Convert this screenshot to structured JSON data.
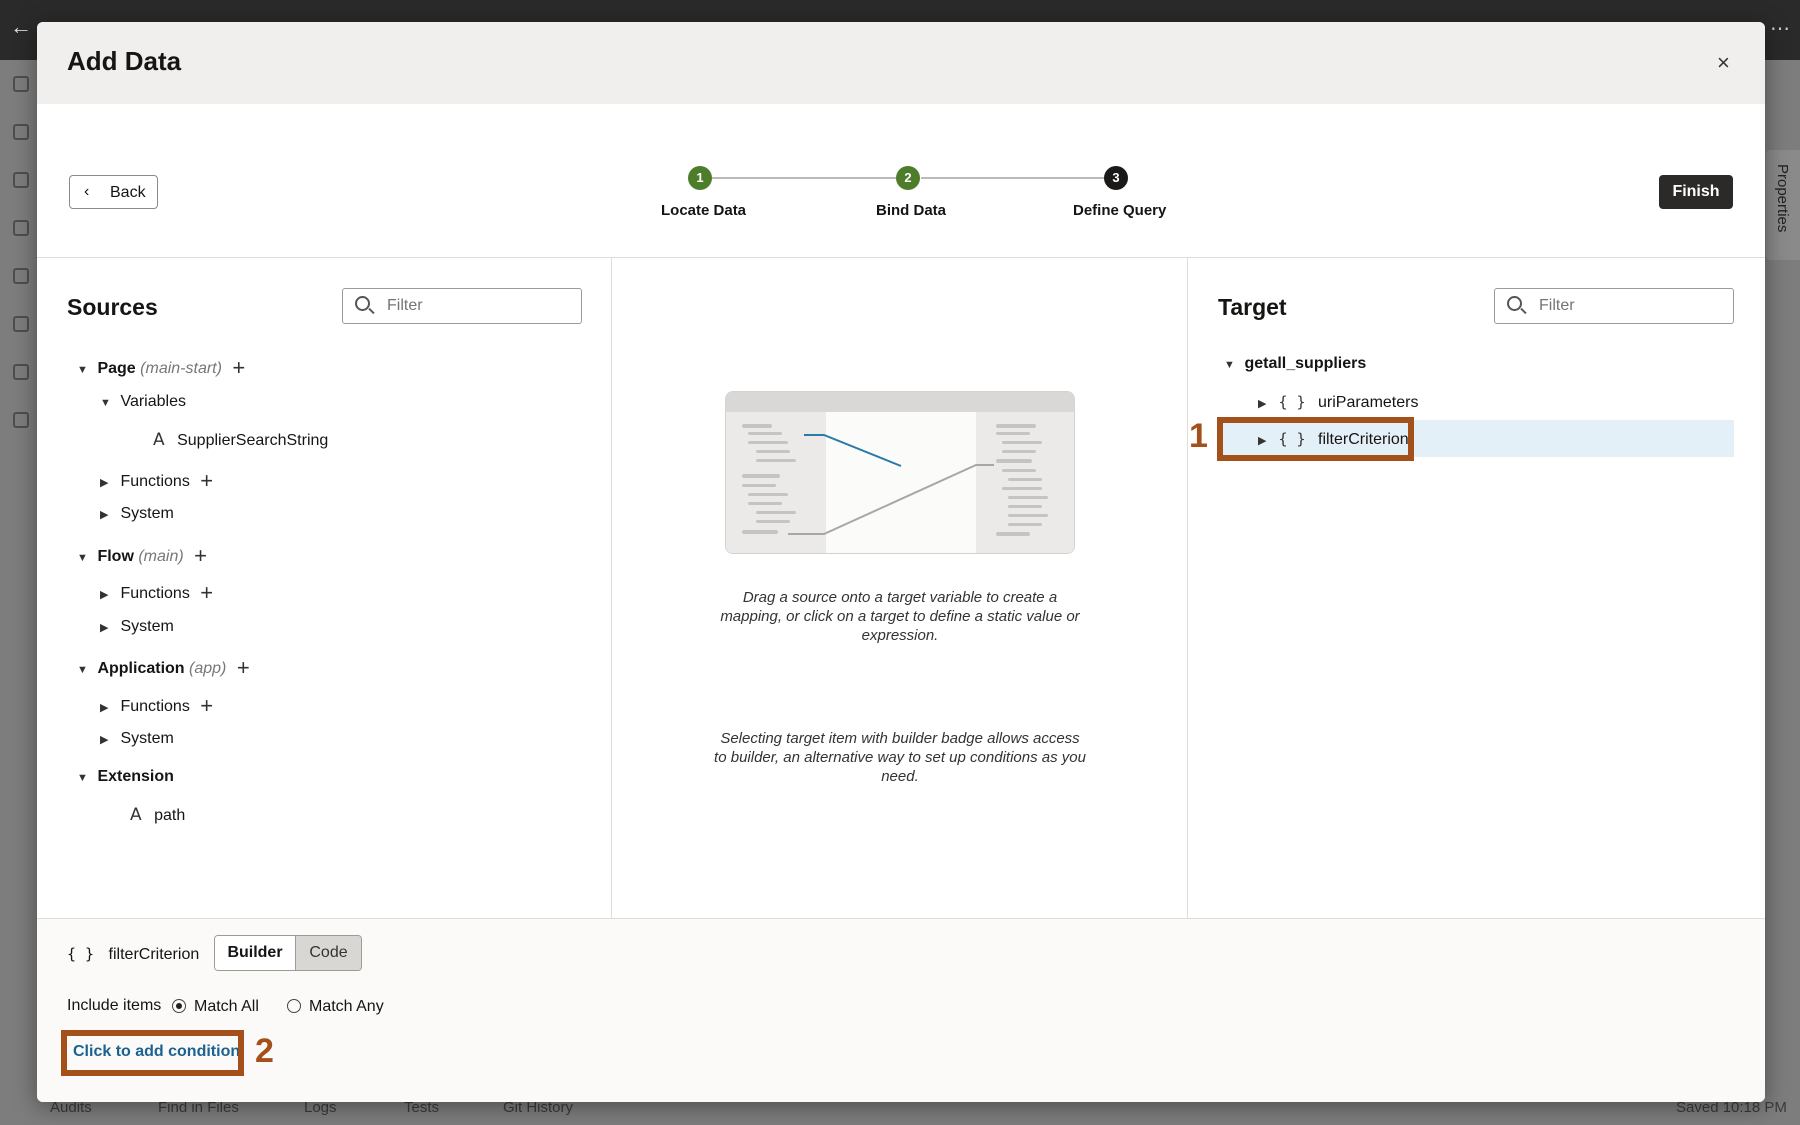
{
  "dialog": {
    "title": "Add Data",
    "close_label": "×"
  },
  "wizard": {
    "back_label": "Back",
    "finish_label": "Finish",
    "steps": [
      {
        "number": "1",
        "label": "Locate Data",
        "state": "done"
      },
      {
        "number": "2",
        "label": "Bind Data",
        "state": "done"
      },
      {
        "number": "3",
        "label": "Define Query",
        "state": "current"
      }
    ]
  },
  "sources": {
    "title": "Sources",
    "filter_placeholder": "Filter",
    "tree": {
      "page": {
        "label": "Page",
        "sub": "(main-start)"
      },
      "variables": "Variables",
      "supplier_var": "SupplierSearchString",
      "page_functions": "Functions",
      "page_system": "System",
      "flow": {
        "label": "Flow",
        "sub": "(main)"
      },
      "flow_functions": "Functions",
      "flow_system": "System",
      "application": {
        "label": "Application",
        "sub": "(app)"
      },
      "app_functions": "Functions",
      "app_system": "System",
      "extension": "Extension",
      "path": "path"
    }
  },
  "middle": {
    "hint1": "Drag a source onto a target variable to create a mapping, or click on a target to define a static value or expression.",
    "hint2": "Selecting target item with builder badge allows access to builder, an alternative way to set up conditions as you need."
  },
  "target": {
    "title": "Target",
    "filter_placeholder": "Filter",
    "root": "getall_suppliers",
    "items": [
      "uriParameters",
      "filterCriterion"
    ]
  },
  "builder": {
    "name": "filterCriterion",
    "mode_builder": "Builder",
    "mode_code": "Code",
    "include_label": "Include items",
    "match_all": "Match All",
    "match_any": "Match Any",
    "add_condition": "Click to add condition"
  },
  "annotations": {
    "marker1": "1",
    "marker2": "2"
  },
  "background": {
    "footer_items": [
      "Audits",
      "Find in Files",
      "Logs",
      "Tests",
      "Git History"
    ],
    "saved": "Saved 10:18 PM",
    "properties_tab": "Properties"
  },
  "colors": {
    "step_done": "#4d7d2a",
    "step_current": "#1a1918",
    "highlight": "#a3501b",
    "link": "#1a6291",
    "selection": "#e4f0f7"
  }
}
